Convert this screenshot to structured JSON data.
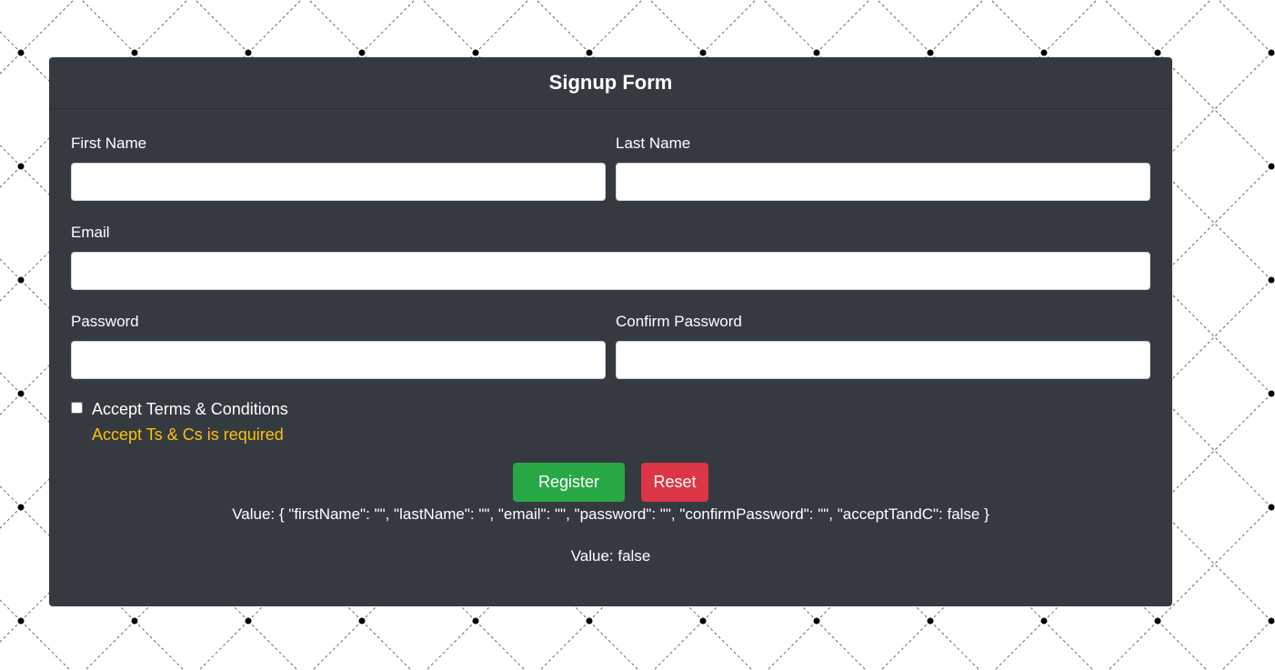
{
  "form": {
    "title": "Signup Form",
    "first_name": {
      "label": "First Name",
      "value": ""
    },
    "last_name": {
      "label": "Last Name",
      "value": ""
    },
    "email": {
      "label": "Email",
      "value": ""
    },
    "password": {
      "label": "Password",
      "value": ""
    },
    "confirm_password": {
      "label": "Confirm Password",
      "value": ""
    },
    "accept_terms": {
      "label": "Accept Terms & Conditions",
      "checked": false
    },
    "error": "Accept Ts & Cs is required",
    "buttons": {
      "register": "Register",
      "reset": "Reset"
    },
    "value_json": "Value: { \"firstName\": \"\", \"lastName\": \"\", \"email\": \"\", \"password\": \"\", \"confirmPassword\": \"\", \"acceptTandC\": false }",
    "value_valid": "Value: false"
  },
  "colors": {
    "card_bg": "#343a40",
    "error": "#ffc107",
    "register": "#28a745",
    "reset": "#dc3545"
  }
}
